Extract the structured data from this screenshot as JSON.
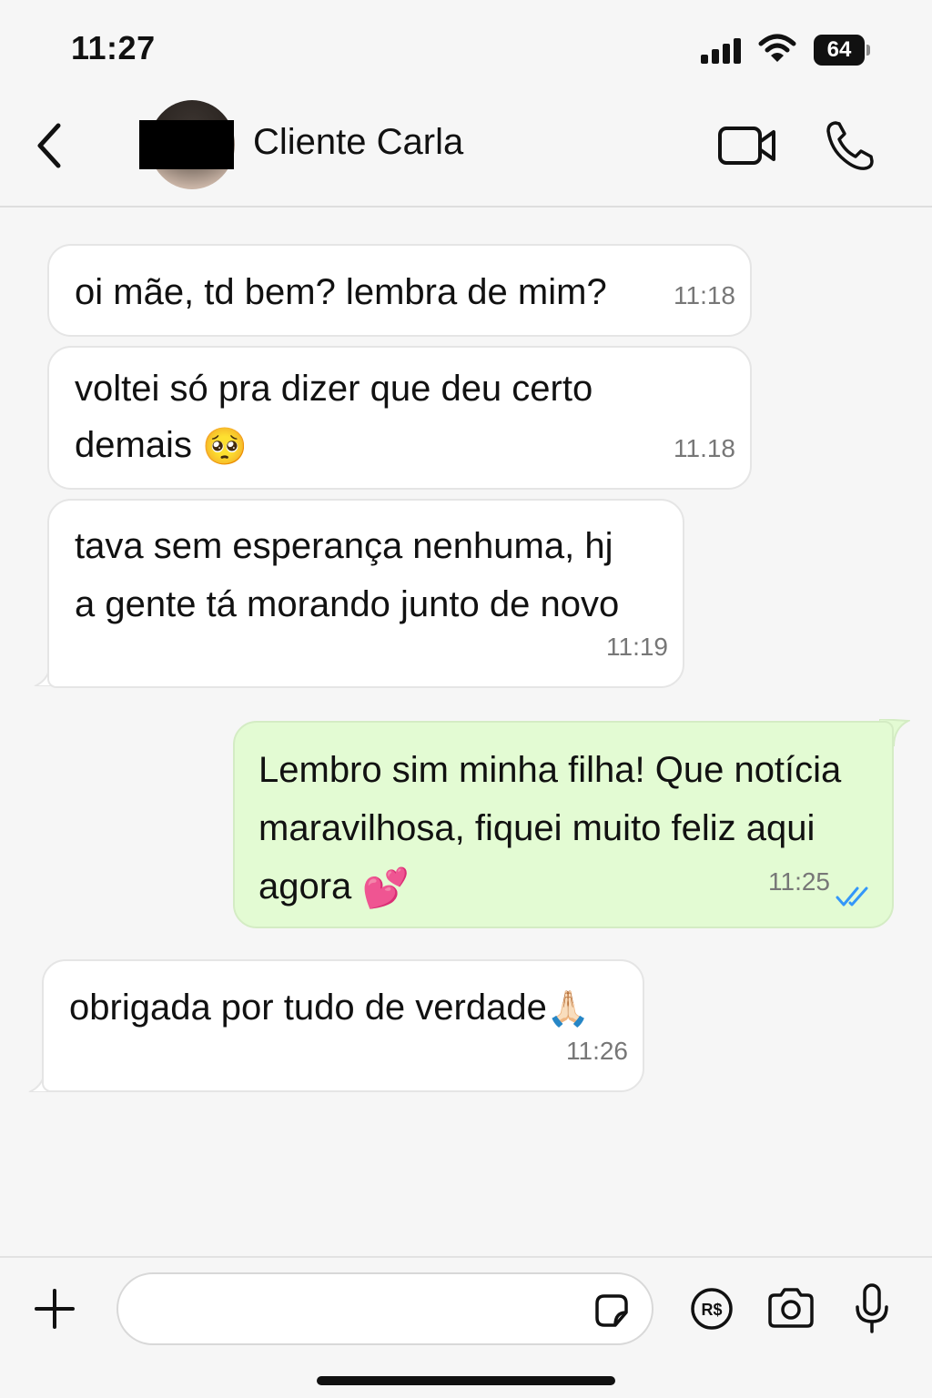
{
  "status_bar": {
    "time": "11:27",
    "battery_level": "64",
    "icons": [
      "signal-icon",
      "wifi-icon",
      "battery-icon"
    ]
  },
  "header": {
    "contact_name": "Cliente Carla",
    "icons": [
      "back-chevron-icon",
      "avatar",
      "video-call-icon",
      "phone-call-icon"
    ]
  },
  "messages": [
    {
      "direction": "incoming",
      "text": "oi mãe, td bem? lembra de mim?",
      "time": "11:18"
    },
    {
      "direction": "incoming",
      "text": "voltei só pra dizer que deu certo\ndemais",
      "emoji": "🥺",
      "time": "11.18"
    },
    {
      "direction": "incoming",
      "text": "tava sem esperança nenhuma, hj\na gente tá morando junto de novo",
      "time": "11:19"
    },
    {
      "direction": "outgoing",
      "text": "Lembro sim minha filha! Que notícia\nmaravilhosa, fiquei muito feliz aqui\nagora",
      "emoji": "💕",
      "time": "11:25",
      "read_status": "read"
    },
    {
      "direction": "incoming",
      "text": "obrigada por tudo de verdade",
      "emoji": "🙏🏻",
      "time": "11:26"
    }
  ],
  "input_bar": {
    "placeholder": "",
    "icons": [
      "plus-icon",
      "sticker-icon",
      "payment-icon",
      "camera-icon",
      "microphone-icon"
    ]
  },
  "colors": {
    "incoming_bubble": "#ffffff",
    "outgoing_bubble": "#e3fbd3",
    "read_ticks": "#3497f9",
    "background": "#f6f6f6"
  }
}
